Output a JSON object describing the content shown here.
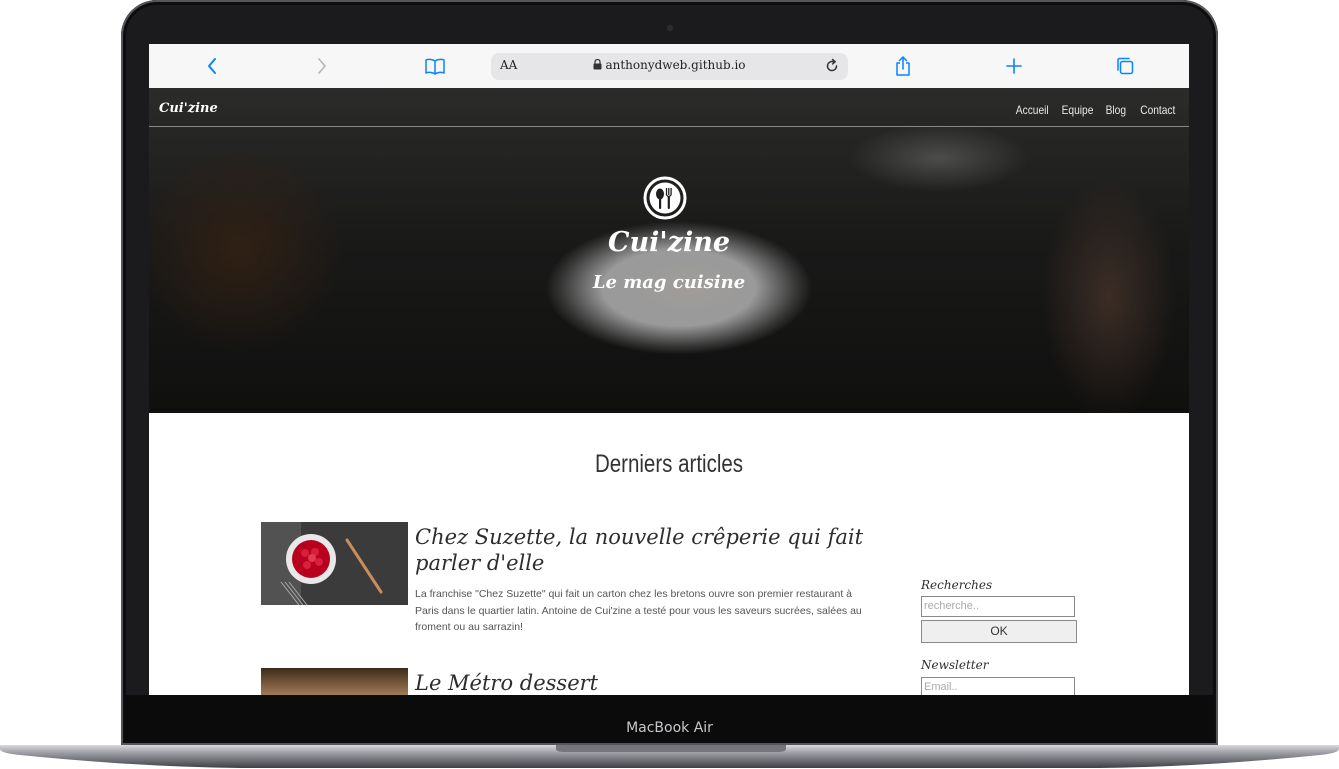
{
  "device": {
    "model_label": "MacBook Air"
  },
  "browser": {
    "text_size_label": "AA",
    "url": "anthonydweb.github.io",
    "icons": [
      "back-icon",
      "forward-icon",
      "bookmarks-icon",
      "lock-icon",
      "reload-icon",
      "share-icon",
      "new-tab-icon",
      "tabs-icon"
    ],
    "accent_color": "#0a84ff"
  },
  "site": {
    "brand": "Cui'zine",
    "nav": [
      "Accueil",
      "Equipe",
      "Blog",
      "Contact"
    ],
    "hero": {
      "title": "Cui'zine",
      "subtitle": "Le mag cuisine",
      "logo_icon": "spoon-fork-icon"
    },
    "section_title": "Derniers articles",
    "articles": [
      {
        "title_line1": "Chez Suzette, la nouvelle crêperie qui fait",
        "title_line2": "parler d'elle",
        "excerpt": "La franchise \"Chez Suzette\" qui fait un carton chez les bretons ouvre son premier restaurant à Paris dans le quartier latin. Antoine de Cui'zine a testé pour vous les saveurs sucrées, salées au froment ou au sarrazin!"
      },
      {
        "title_line1": "Le Métro dessert"
      }
    ],
    "sidebar": {
      "search_label": "Recherches",
      "search_placeholder": "recherche..",
      "search_button": "OK",
      "newsletter_label": "Newsletter",
      "email_placeholder": "Email.."
    }
  }
}
